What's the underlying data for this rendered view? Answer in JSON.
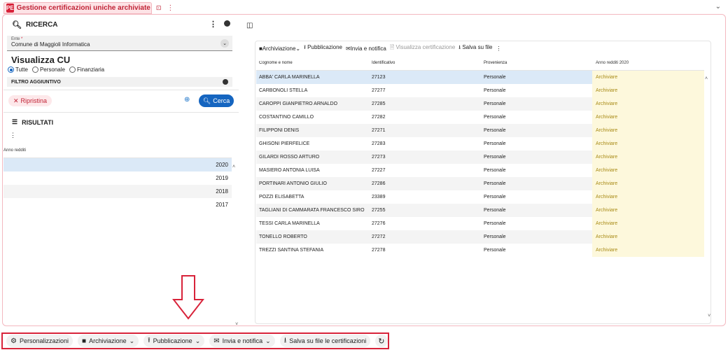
{
  "tab": {
    "badge": "PE",
    "title": "Gestione certificazioni uniche archiviate",
    "bookmark_icon": "bookmark-icon",
    "menu_icon": "kebab-icon"
  },
  "search": {
    "title": "RICERCA",
    "ente": {
      "label": "Ente",
      "required": "*",
      "value": "Comune di Maggioli Informatica"
    },
    "section_title": "Visualizza CU",
    "radios": [
      {
        "label": "Tutte",
        "checked": true
      },
      {
        "label": "Personale",
        "checked": false
      },
      {
        "label": "Finanziaria",
        "checked": false
      }
    ],
    "filter_label": "FILTRO AGGIUNTIVO",
    "reset_label": "Ripristina",
    "search_label": "Cerca"
  },
  "results": {
    "title": "RISULTATI",
    "column": "Anno redditi",
    "rows": [
      "2020",
      "2019",
      "2018",
      "2017"
    ]
  },
  "toolbar": {
    "archive": "Archiviazione",
    "publish": "Pubblicazione",
    "send": "Invia e notifica",
    "view": "Visualizza certificazione",
    "save": "Salva su file"
  },
  "grid": {
    "headers": [
      "Cognome e nome",
      "Identificativo",
      "Provenienza",
      "Anno redditi 2020"
    ],
    "rows": [
      [
        "ABBA' CARLA MARINELLA",
        "27123",
        "Personale",
        "Archiviare"
      ],
      [
        "CARBONOLI STELLA",
        "27277",
        "Personale",
        "Archiviare"
      ],
      [
        "CAROPPI GIANPIETRO ARNALDO",
        "27285",
        "Personale",
        "Archiviare"
      ],
      [
        "COSTANTINO CAMILLO",
        "27282",
        "Personale",
        "Archiviare"
      ],
      [
        "FILIPPONI DENIS",
        "27271",
        "Personale",
        "Archiviare"
      ],
      [
        "GHISONI PIERFELICE",
        "27283",
        "Personale",
        "Archiviare"
      ],
      [
        "GILARDI ROSSO ARTURO",
        "27273",
        "Personale",
        "Archiviare"
      ],
      [
        "MASIERO ANTONIA LUISA",
        "27227",
        "Personale",
        "Archiviare"
      ],
      [
        "PORTINARI ANTONIO GIULIO",
        "27286",
        "Personale",
        "Archiviare"
      ],
      [
        "POZZI ELISABETTA",
        "23389",
        "Personale",
        "Archiviare"
      ],
      [
        "TAGLIANI DI CAMMARATA FRANCESCO SIRO",
        "27255",
        "Personale",
        "Archiviare"
      ],
      [
        "TESSI CARLA MARINELLA",
        "27276",
        "Personale",
        "Archiviare"
      ],
      [
        "TONELLO ROBERTO",
        "27272",
        "Personale",
        "Archiviare"
      ],
      [
        "TREZZI SANTINA STEFANIA",
        "27278",
        "Personale",
        "Archiviare"
      ]
    ]
  },
  "bottom_bar": {
    "customize": "Personalizzazioni",
    "archive": "Archiviazione",
    "publish": "Pubblicazione",
    "send": "Invia e notifica",
    "save": "Salva su file le certificazioni"
  },
  "colors": {
    "accent": "#d8233a",
    "primary": "#1565c0",
    "selected_row": "#dbe9f7",
    "status_cell": "#fdf8dc"
  }
}
